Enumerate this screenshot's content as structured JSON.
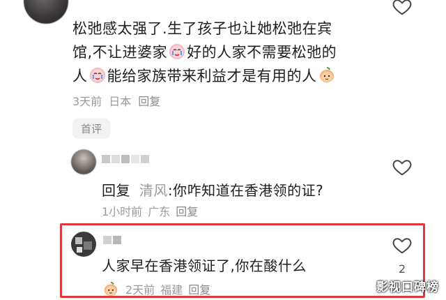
{
  "comment": {
    "text_line1": "松弛感太强了.生了孩子也让她松弛在宾",
    "text_line2a": "馆,不让进婆家",
    "text_line2b": "好的人家不需要松弛的",
    "text_line3a": "人",
    "text_line3b": "能给家族带来利益才是有用的人",
    "time": "3天前",
    "location": "日本",
    "reply_label": "回复"
  },
  "first_comment_tag": "首评",
  "reply1": {
    "prefix": "回复",
    "reply_to": "清风",
    "text": ":你咋知道在香港领的证?",
    "time": "1小时前",
    "location": "广东",
    "reply_label": "回复"
  },
  "reply2": {
    "text": "人家早在香港领证了,你在酸什么",
    "time": "2天前",
    "location": "福建",
    "reply_label": "回复",
    "like_count": "2"
  },
  "watermark": "影视口碑榜",
  "colors": {
    "highlight_border": "#e0393e",
    "reply_name": "#9a9a9a",
    "meta": "#9a9a9a"
  }
}
